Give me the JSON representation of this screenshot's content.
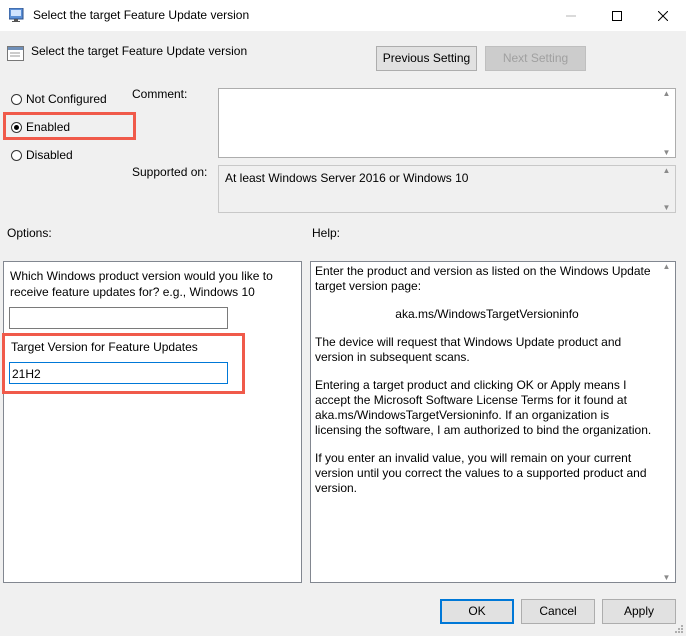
{
  "window": {
    "title": "Select the target Feature Update version"
  },
  "header": {
    "policy_name": "Select the target Feature Update version",
    "prev_label": "Previous Setting",
    "next_label": "Next Setting"
  },
  "state": {
    "options": [
      {
        "label": "Not Configured",
        "selected": false
      },
      {
        "label": "Enabled",
        "selected": true
      },
      {
        "label": "Disabled",
        "selected": false
      }
    ],
    "comment_label": "Comment:",
    "comment_value": "",
    "supported_label": "Supported on:",
    "supported_value": "At least Windows Server 2016 or Windows 10"
  },
  "options_pane": {
    "heading": "Options:",
    "question": "Which Windows product version would you like to receive feature updates for? e.g., Windows 10",
    "product_value": "",
    "target_label": "Target Version for Feature Updates",
    "target_value": "21H2"
  },
  "help_pane": {
    "heading": "Help:",
    "paragraphs": [
      "Enter the product and version as listed on the Windows Update target version page:",
      "aka.ms/WindowsTargetVersioninfo",
      "The device will request that Windows Update product and version in subsequent scans.",
      "Entering a target product and clicking OK or Apply means I accept the Microsoft Software License Terms for it found at aka.ms/WindowsTargetVersioninfo. If an organization is licensing the software, I am authorized to bind the organization.",
      "If you enter an invalid value, you will remain on your current version until you correct the values to a supported product and version."
    ]
  },
  "footer": {
    "ok_label": "OK",
    "cancel_label": "Cancel",
    "apply_label": "Apply"
  },
  "colors": {
    "highlight": "#f05a4a",
    "focus": "#0078d7"
  }
}
